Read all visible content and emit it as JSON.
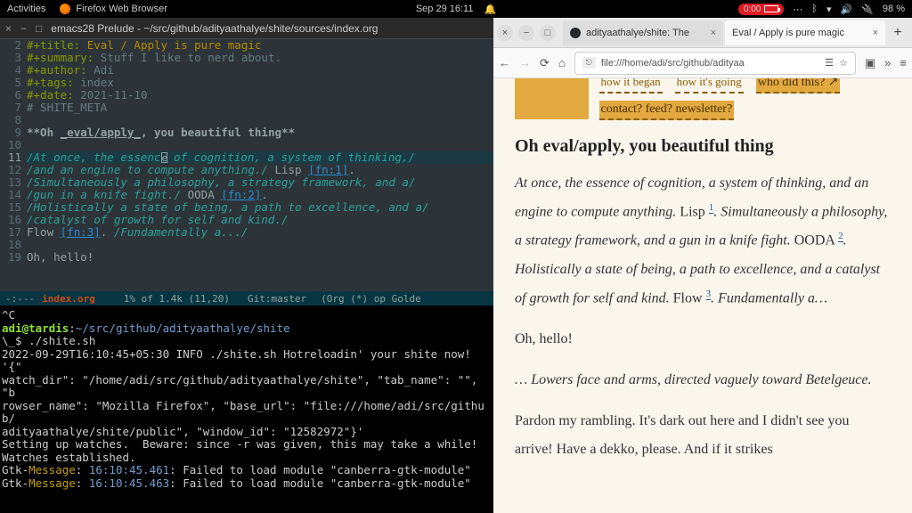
{
  "topbar": {
    "activities": "Activities",
    "app": "Firefox Web Browser",
    "datetime": "Sep 29  16:11",
    "battery_time": "0:00",
    "battery_pct": "98 %"
  },
  "emacs": {
    "title": "emacs28 Prelude - ~/src/github/adityaathalye/shite/sources/index.org",
    "modeline": {
      "prefix": "-:---",
      "buffer": "index.org",
      "pos": "1% of 1.4k (11,20)",
      "git": "Git:master",
      "modes": "(Org (*) op Golde"
    },
    "lines": [
      {
        "n": "2",
        "seg": [
          [
            "kw",
            "#+title: "
          ],
          [
            "title-val",
            "Eval / Apply is pure magic"
          ]
        ]
      },
      {
        "n": "3",
        "seg": [
          [
            "kw",
            "#+summary: "
          ],
          [
            "comment",
            "Stuff I like to nerd about."
          ]
        ]
      },
      {
        "n": "4",
        "seg": [
          [
            "kw",
            "#+author: "
          ],
          [
            "comment",
            "Adi"
          ]
        ]
      },
      {
        "n": "5",
        "seg": [
          [
            "kw",
            "#+tags: "
          ],
          [
            "comment",
            "index"
          ]
        ]
      },
      {
        "n": "6",
        "seg": [
          [
            "kw",
            "#+date: "
          ],
          [
            "comment",
            "2021-11-10"
          ]
        ]
      },
      {
        "n": "7",
        "seg": [
          [
            "comment",
            "# SHITE_META"
          ]
        ]
      },
      {
        "n": "8",
        "seg": [
          [
            "",
            ""
          ]
        ]
      },
      {
        "n": "9",
        "seg": [
          [
            "bold",
            "**Oh "
          ],
          [
            "bold ul",
            "_eval/apply_"
          ],
          [
            "bold",
            ", you beautiful thing**"
          ]
        ]
      },
      {
        "n": "10",
        "seg": [
          [
            "",
            ""
          ]
        ]
      },
      {
        "n": "11",
        "seg": [
          [
            "str",
            "/At once, the essenc"
          ],
          [
            "cursor",
            "e"
          ],
          [
            "str",
            " of cognition, a system of thinking,/"
          ]
        ],
        "current": true
      },
      {
        "n": "12",
        "seg": [
          [
            "str",
            "/and an engine to compute anything./"
          ],
          [
            "",
            " Lisp "
          ],
          [
            "link",
            "[fn:1]"
          ],
          [
            "",
            "."
          ]
        ]
      },
      {
        "n": "13",
        "seg": [
          [
            "str",
            "/Simultaneously a philosophy, a strategy framework, and a/"
          ]
        ]
      },
      {
        "n": "14",
        "seg": [
          [
            "str",
            "/gun in a knife fight./"
          ],
          [
            "",
            " OODA "
          ],
          [
            "link",
            "[fn:2]"
          ],
          [
            "",
            "."
          ]
        ]
      },
      {
        "n": "15",
        "seg": [
          [
            "str",
            "/Holistically a state of being, a path to excellence, and a/"
          ]
        ]
      },
      {
        "n": "16",
        "seg": [
          [
            "str",
            "/catalyst of growth for self and kind./"
          ]
        ]
      },
      {
        "n": "17",
        "seg": [
          [
            "",
            "Flow "
          ],
          [
            "link",
            "[fn:3]"
          ],
          [
            "",
            ". "
          ],
          [
            "str",
            "/Fundamentally a.../"
          ]
        ]
      },
      {
        "n": "18",
        "seg": [
          [
            "",
            ""
          ]
        ]
      },
      {
        "n": "19",
        "seg": [
          [
            "",
            "Oh, hello!"
          ]
        ]
      }
    ]
  },
  "terminal": {
    "lines": [
      {
        "seg": [
          [
            "",
            "^C"
          ]
        ]
      },
      {
        "seg": [
          [
            "tgreen",
            "adi@tardis"
          ],
          [
            "",
            ":"
          ],
          [
            "tblue",
            "~/src/github/adityaathalye/shite"
          ]
        ]
      },
      {
        "seg": [
          [
            "",
            "\\_$ ./shite.sh"
          ]
        ]
      },
      {
        "seg": [
          [
            "",
            "2022-09-29T16:10:45+05:30 INFO ./shite.sh Hotreloadin' your shite now! '{\""
          ]
        ]
      },
      {
        "seg": [
          [
            "",
            "watch_dir\": \"/home/adi/src/github/adityaathalye/shite\", \"tab_name\": \"\", \"b"
          ]
        ]
      },
      {
        "seg": [
          [
            "",
            "rowser_name\": \"Mozilla Firefox\", \"base_url\": \"file:///home/adi/src/github/"
          ]
        ]
      },
      {
        "seg": [
          [
            "",
            "adityaathalye/shite/public\", \"window_id\": \"12582972\"}'"
          ]
        ]
      },
      {
        "seg": [
          [
            "",
            "Setting up watches.  Beware: since -r was given, this may take a while!"
          ]
        ]
      },
      {
        "seg": [
          [
            "",
            "Watches established."
          ]
        ]
      },
      {
        "seg": [
          [
            "",
            "Gtk-"
          ],
          [
            "tyellow",
            "Message"
          ],
          [
            "",
            ": "
          ],
          [
            "tblue",
            "16:10:45.461"
          ],
          [
            "",
            ": Failed to load module \"canberra-gtk-module\""
          ]
        ]
      },
      {
        "seg": [
          [
            "",
            "Gtk-"
          ],
          [
            "tyellow",
            "Message"
          ],
          [
            "",
            ": "
          ],
          [
            "tblue",
            "16:10:45.463"
          ],
          [
            "",
            ": Failed to load module \"canberra-gtk-module\""
          ]
        ]
      }
    ]
  },
  "firefox": {
    "tabs": [
      {
        "label": "adityaathalye/shite: The",
        "active": false,
        "icon": "gh"
      },
      {
        "label": "Eval / Apply is pure magic",
        "active": true,
        "icon": ""
      }
    ],
    "url": "file:///home/adi/src/github/adityaa"
  },
  "page": {
    "nav": {
      "row1": [
        "how it began",
        "how it's going"
      ],
      "row2a": "who did this?",
      "row2b": "contact? feed? newsletter?"
    },
    "heading": "Oh eval/apply, you beautiful thing",
    "p1": {
      "s1": "At once, the essence of cognition, a system of thinking, and an engine to compute anything.",
      "s1b": " Lisp ",
      "fn1": "1",
      "s2": ". Simultaneously a philosophy, a strategy framework, and a gun in a knife fight.",
      "s2b": " OODA ",
      "fn2": "2",
      "s3": ". Holistically a state of being, a path to excellence, and a catalyst of growth for self and kind.",
      "s3b": " Flow ",
      "fn3": "3",
      "s4": ". Fundamentally a…"
    },
    "p2": "Oh, hello!",
    "p3": "… Lowers face and arms, directed vaguely toward Betelgeuce.",
    "p4": "Pardon my rambling. It's dark out here and I didn't see you arrive! Have a dekko, please. And if it strikes"
  }
}
